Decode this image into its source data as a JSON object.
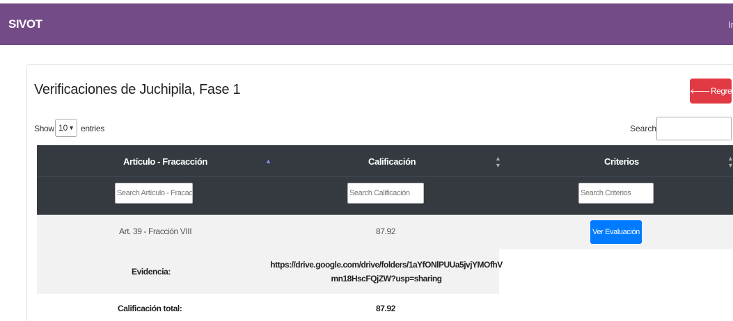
{
  "navbar": {
    "brand": "SIVOT",
    "right_fragment": "Ir"
  },
  "page": {
    "title": "Verificaciones de Juchipila, Fase 1",
    "back_button": "Regresar",
    "back_icon": "arrow-left-icon"
  },
  "table_controls": {
    "show_label": "Show",
    "page_length": "10",
    "entries_label": "entries",
    "search_label": "Search:",
    "search_value": ""
  },
  "table": {
    "columns": [
      {
        "label": "Artículo - Fracacción",
        "filter_placeholder": "Search Artículo - Fracacción"
      },
      {
        "label": "Calificación",
        "filter_placeholder": "Search Calificación"
      },
      {
        "label": "Criterios",
        "filter_placeholder": "Search Criterios"
      }
    ],
    "rows": [
      {
        "articulo": "Art. 39 - Fracción VIII",
        "calificacion": "87.92",
        "criterios_button": "Ver Evaluación"
      }
    ]
  },
  "summary": {
    "evidencia_label": "Evidencia:",
    "evidencia_url": "https://drive.google.com/drive/folders/1aYfONlPUUa5jvjYMOfhVmn18HscFQjZW?usp=sharing",
    "total_label": "Calificación total:",
    "total_value": "87.92"
  },
  "colors": {
    "navbar": "#734b87",
    "table_header": "#343a40",
    "danger": "#e23a45",
    "primary": "#007bff"
  }
}
